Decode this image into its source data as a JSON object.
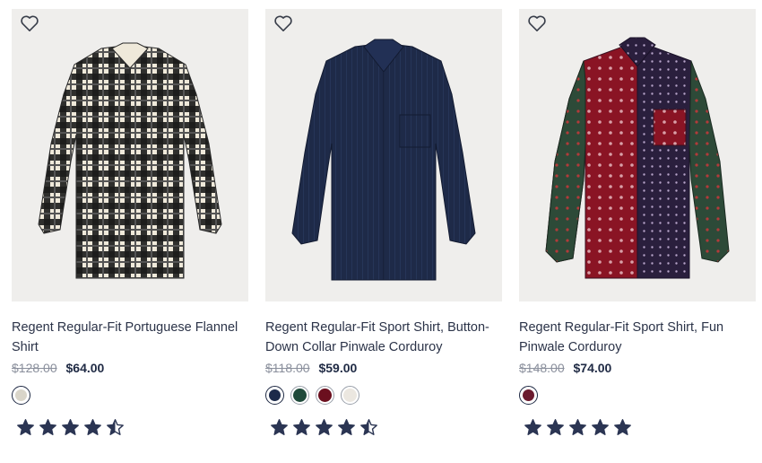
{
  "products": [
    {
      "title": "Regent Regular-Fit Portuguese Flannel Shirt",
      "original_price": "$128.00",
      "sale_price": "$64.00",
      "rating": 4.5,
      "swatches": [
        "#d9d5c9"
      ],
      "selected_swatch": 0,
      "pattern": "plaid"
    },
    {
      "title": "Regent Regular-Fit Sport Shirt, Button-Down Collar Pinwale Corduroy",
      "original_price": "$118.00",
      "sale_price": "$59.00",
      "rating": 4.5,
      "swatches": [
        "#1c2a4a",
        "#1f4a3a",
        "#6b0f1e",
        "#ebe7e0"
      ],
      "selected_swatch": 0,
      "pattern": "navy"
    },
    {
      "title": "Regent Regular-Fit Sport Shirt, Fun Pinwale Corduroy",
      "original_price": "$148.00",
      "sale_price": "$74.00",
      "rating": 5,
      "swatches": [
        "#6b1a2e"
      ],
      "selected_swatch": 0,
      "pattern": "fun"
    }
  ],
  "colors": {
    "star": "#2b3553",
    "heart": "#3a3f4b",
    "image_bg": "#efeeec"
  }
}
